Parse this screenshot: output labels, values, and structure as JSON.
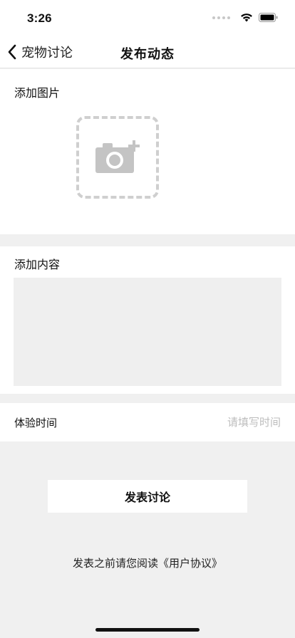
{
  "status_bar": {
    "time": "3:26"
  },
  "nav": {
    "back_label": "宠物讨论",
    "title": "发布动态"
  },
  "image_section": {
    "label": "添加图片"
  },
  "content_section": {
    "label": "添加内容",
    "value": ""
  },
  "time_section": {
    "label": "体验时间",
    "placeholder": "请填写时间",
    "value": ""
  },
  "submit": {
    "label": "发表讨论"
  },
  "agreement": {
    "prefix": "发表之前请您阅读",
    "link": "《用户协议》"
  },
  "icons": [
    "back-chevron-icon",
    "add-photo-camera-icon",
    "signal-icon",
    "wifi-icon",
    "battery-icon"
  ]
}
